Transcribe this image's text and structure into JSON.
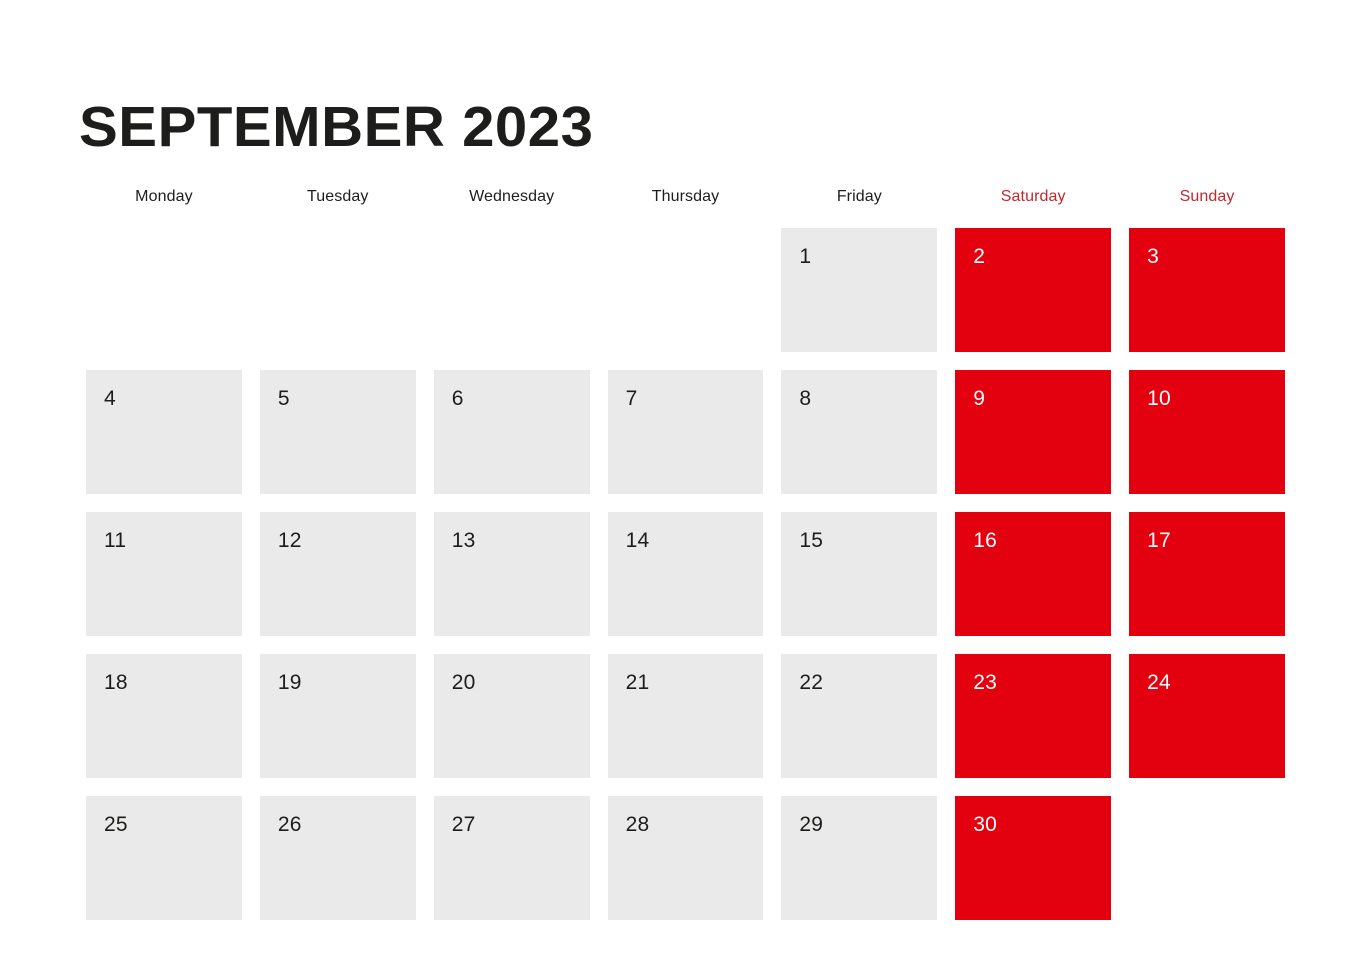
{
  "header": {
    "title": "SEPTEMBER 2023",
    "month": "SEPTEMBER",
    "year": "2023"
  },
  "colors": {
    "weekend_cell_bg": "#e3000f",
    "weekday_cell_bg": "#eaeaea",
    "weekend_header_text": "#c0282d",
    "weekday_header_text": "#1d1d1b",
    "page_bg": "#ffffff",
    "title_text": "#1d1d1b",
    "weekend_number_text": "#ffffff",
    "weekday_number_text": "#1d1d1b"
  },
  "weekdays": [
    {
      "label": "Monday",
      "weekend": false
    },
    {
      "label": "Tuesday",
      "weekend": false
    },
    {
      "label": "Wednesday",
      "weekend": false
    },
    {
      "label": "Thursday",
      "weekend": false
    },
    {
      "label": "Friday",
      "weekend": false
    },
    {
      "label": "Saturday",
      "weekend": true
    },
    {
      "label": "Sunday",
      "weekend": true
    }
  ],
  "weeks": [
    [
      {
        "day": "",
        "empty": true,
        "weekend": false
      },
      {
        "day": "",
        "empty": true,
        "weekend": false
      },
      {
        "day": "",
        "empty": true,
        "weekend": false
      },
      {
        "day": "",
        "empty": true,
        "weekend": false
      },
      {
        "day": "1",
        "empty": false,
        "weekend": false
      },
      {
        "day": "2",
        "empty": false,
        "weekend": true
      },
      {
        "day": "3",
        "empty": false,
        "weekend": true
      }
    ],
    [
      {
        "day": "4",
        "empty": false,
        "weekend": false
      },
      {
        "day": "5",
        "empty": false,
        "weekend": false
      },
      {
        "day": "6",
        "empty": false,
        "weekend": false
      },
      {
        "day": "7",
        "empty": false,
        "weekend": false
      },
      {
        "day": "8",
        "empty": false,
        "weekend": false
      },
      {
        "day": "9",
        "empty": false,
        "weekend": true
      },
      {
        "day": "10",
        "empty": false,
        "weekend": true
      }
    ],
    [
      {
        "day": "11",
        "empty": false,
        "weekend": false
      },
      {
        "day": "12",
        "empty": false,
        "weekend": false
      },
      {
        "day": "13",
        "empty": false,
        "weekend": false
      },
      {
        "day": "14",
        "empty": false,
        "weekend": false
      },
      {
        "day": "15",
        "empty": false,
        "weekend": false
      },
      {
        "day": "16",
        "empty": false,
        "weekend": true
      },
      {
        "day": "17",
        "empty": false,
        "weekend": true
      }
    ],
    [
      {
        "day": "18",
        "empty": false,
        "weekend": false
      },
      {
        "day": "19",
        "empty": false,
        "weekend": false
      },
      {
        "day": "20",
        "empty": false,
        "weekend": false
      },
      {
        "day": "21",
        "empty": false,
        "weekend": false
      },
      {
        "day": "22",
        "empty": false,
        "weekend": false
      },
      {
        "day": "23",
        "empty": false,
        "weekend": true
      },
      {
        "day": "24",
        "empty": false,
        "weekend": true
      }
    ],
    [
      {
        "day": "25",
        "empty": false,
        "weekend": false
      },
      {
        "day": "26",
        "empty": false,
        "weekend": false
      },
      {
        "day": "27",
        "empty": false,
        "weekend": false
      },
      {
        "day": "28",
        "empty": false,
        "weekend": false
      },
      {
        "day": "29",
        "empty": false,
        "weekend": false
      },
      {
        "day": "30",
        "empty": false,
        "weekend": true
      },
      {
        "day": "",
        "empty": true,
        "weekend": true
      }
    ]
  ]
}
